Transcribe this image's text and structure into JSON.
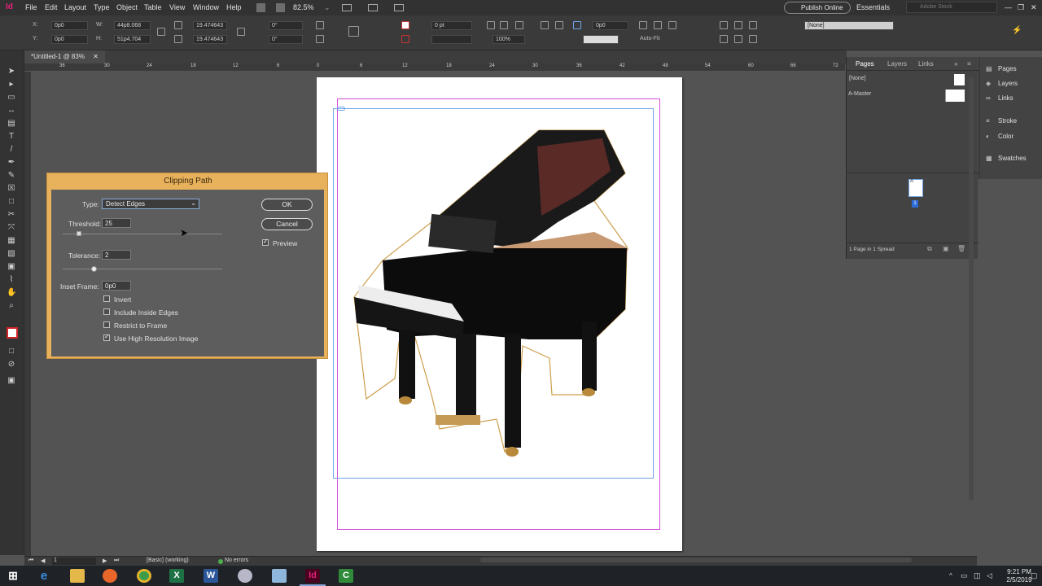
{
  "app": {
    "logo_text": "Id"
  },
  "menu": {
    "items": [
      "File",
      "Edit",
      "Layout",
      "Type",
      "Object",
      "Table",
      "View",
      "Window",
      "Help"
    ],
    "zoom": "82.5%",
    "publish_online": "Publish Online",
    "workspace": "Essentials",
    "search_placeholder": "Adobe Stock"
  },
  "controlbar": {
    "x_label": "X:",
    "x_value": "0p0",
    "y_label": "Y:",
    "y_value": "0p0",
    "w_label": "W:",
    "w_value": "44p8.068",
    "h_label": "H:",
    "h_value": "51p4.704",
    "scale_x": "19.474643",
    "scale_y": "19.474643",
    "rotate": "0°",
    "shear": "0°",
    "stroke_weight": "0 pt",
    "zoom_pct": "100%",
    "offset": "0p0",
    "autofit_label": "Auto-Fit",
    "object_style": "[None]"
  },
  "document": {
    "tab_title": "*Untitled-1 @ 83%"
  },
  "ruler": {
    "ticks": [
      "36",
      "30",
      "24",
      "18",
      "12",
      "6",
      "0",
      "6",
      "12",
      "18",
      "24",
      "30",
      "36",
      "42",
      "48",
      "54",
      "60",
      "66",
      "72",
      "78"
    ]
  },
  "dialog": {
    "title": "Clipping Path",
    "type_label": "Type:",
    "type_value": "Detect Edges",
    "threshold_label": "Threshold:",
    "threshold_value": "25",
    "threshold_level": 0.1,
    "tolerance_label": "Tolerance:",
    "tolerance_value": "2",
    "tolerance_level": 0.2,
    "inset_label": "Inset Frame:",
    "inset_value": "0p0",
    "invert_label": "Invert",
    "include_inside_label": "Include Inside Edges",
    "restrict_label": "Restrict to Frame",
    "high_res_label": "Use High Resolution Image",
    "ok_label": "OK",
    "cancel_label": "Cancel",
    "preview_label": "Preview"
  },
  "pages_panel": {
    "tabs": [
      "Pages",
      "Layers",
      "Links"
    ],
    "none_label": "[None]",
    "master_label": "A-Master",
    "page_number": "1",
    "page_master_letter": "A",
    "footer": "1 Page in 1 Spread"
  },
  "side_panels": {
    "items": [
      "Pages",
      "Layers",
      "Links",
      "Stroke",
      "Color",
      "Swatches"
    ]
  },
  "statusbar": {
    "page": "1",
    "preflight_profile": "[Basic] (working)",
    "errors": "No errors"
  },
  "taskbar": {
    "time": "9:21 PM",
    "date": "2/5/2019",
    "icons": [
      "windows-start",
      "edge",
      "file-explorer",
      "firefox",
      "chrome",
      "excel",
      "word",
      "paint",
      "notepad",
      "indesign",
      "camtasia"
    ],
    "colors": {
      "indesign": "#e0217a",
      "excel": "#1e7145",
      "word": "#2b579a",
      "taskbar": "#1f2227"
    }
  }
}
